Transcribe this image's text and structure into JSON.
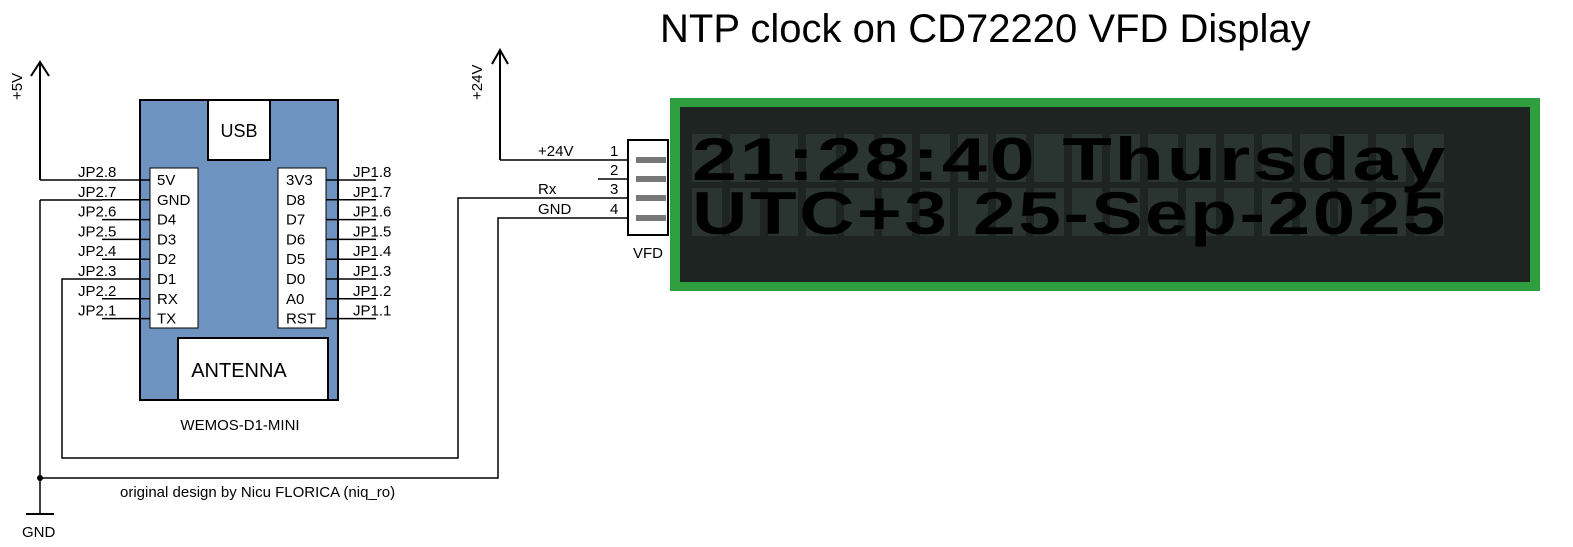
{
  "title": "NTP clock on CD72220 VFD Display",
  "power": {
    "plus5v": "+5V",
    "plus24v": "+24V",
    "gnd": "GND"
  },
  "module": {
    "name": "WEMOS-D1-MINI",
    "usb_label": "USB",
    "antenna_label": "ANTENNA",
    "left_pins": [
      "5V",
      "GND",
      "D4",
      "D3",
      "D2",
      "D1",
      "RX",
      "TX"
    ],
    "right_pins": [
      "3V3",
      "D8",
      "D7",
      "D6",
      "D5",
      "D0",
      "A0",
      "RST"
    ],
    "left_jp": [
      "JP2.8",
      "JP2.7",
      "JP2.6",
      "JP2.5",
      "JP2.4",
      "JP2.3",
      "JP2.2",
      "JP2.1"
    ],
    "right_jp": [
      "JP1.8",
      "JP1.7",
      "JP1.6",
      "JP1.5",
      "JP1.4",
      "JP1.3",
      "JP1.2",
      "JP1.1"
    ]
  },
  "connector": {
    "name": "VFD",
    "pin_numbers": [
      "1",
      "2",
      "3",
      "4"
    ],
    "pin_signals": [
      "+24V",
      "",
      "Rx",
      "GND"
    ]
  },
  "display": {
    "line1": "21:28:40 Thursday",
    "line2": "UTC+3   25-Sep-2025"
  },
  "credit": "original design by Nicu FLORICA (niq_ro)",
  "colors": {
    "module_fill": "#6f93c0",
    "display_frame": "#2e9e3e",
    "display_bg": "#1e2422",
    "vfd_glow": "#7fe0d6"
  }
}
